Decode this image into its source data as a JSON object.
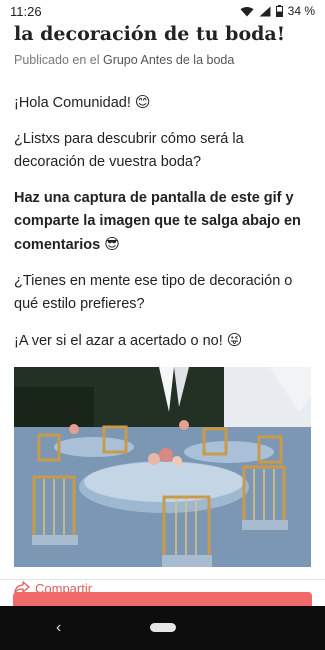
{
  "status": {
    "time": "11:26",
    "battery": "34 %"
  },
  "post": {
    "title": "la decoración de tu boda!",
    "meta_prefix": "Publicado en el",
    "group": "Grupo Antes de la boda",
    "paragraphs": [
      {
        "text": "¡Hola Comunidad!",
        "emoji": "😊"
      },
      {
        "text": "¿Listxs para descubrir cómo será la decoración de vuestra boda?"
      },
      {
        "text": "Haz una captura de pantalla de este gif y comparte la imagen que te salga abajo en comentarios",
        "emoji": "😎"
      },
      {
        "text": "¿Tienes en mente ese tipo de decoración o qué estilo prefieres?"
      },
      {
        "text": "¡A ver si el azar a acertado o no!",
        "emoji": "😜"
      }
    ],
    "share_label": "Compartir"
  },
  "colors": {
    "accent": "#f16a6a",
    "share": "#e05a5a"
  },
  "icons": {
    "wifi": "wifi-icon",
    "signal": "signal-icon",
    "battery": "battery-icon",
    "share": "share-icon",
    "back": "back-icon",
    "home": "home-pill-icon"
  }
}
